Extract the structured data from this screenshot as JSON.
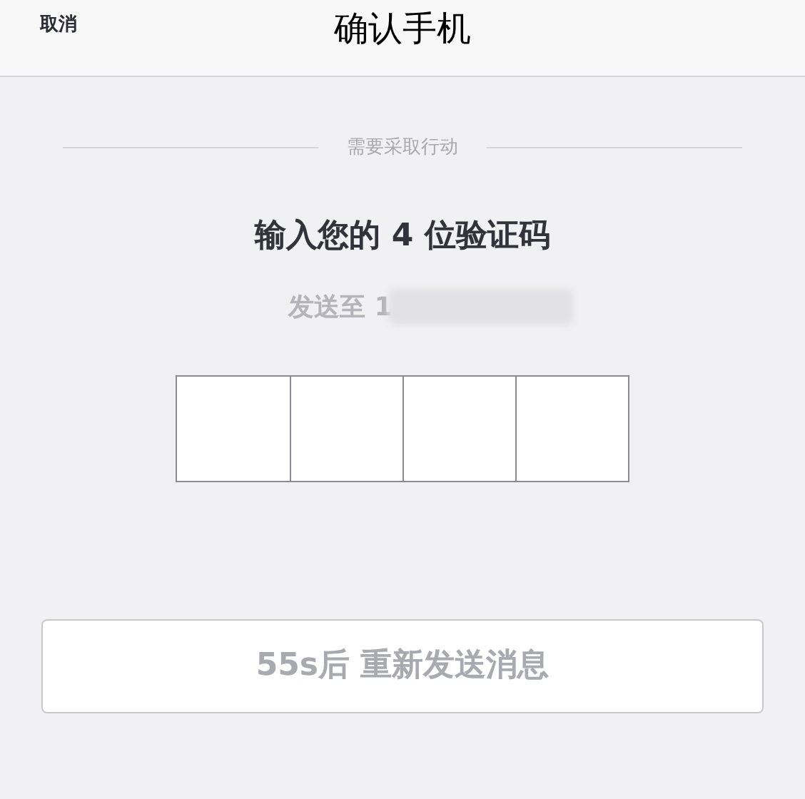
{
  "header": {
    "cancel": "取消",
    "title": "确认手机"
  },
  "divider_label": "需要采取行动",
  "heading": "输入您的 4 位验证码",
  "sent_to": "发送至 1",
  "code_boxes": [
    {
      "filled": false
    },
    {
      "filled": false
    },
    {
      "filled": false
    },
    {
      "filled": false
    }
  ],
  "resend_button": {
    "label": "55s后 重新发送消息",
    "disabled": true
  }
}
